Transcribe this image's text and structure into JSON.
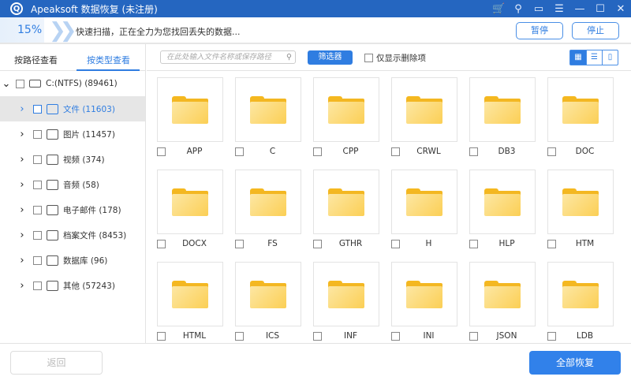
{
  "app": {
    "title": "Apeaksoft 数据恢复 (未注册)",
    "logo": "Q"
  },
  "titlebar_icons": [
    {
      "name": "cart-icon",
      "glyph": "🛒"
    },
    {
      "name": "key-icon",
      "glyph": "⚲"
    },
    {
      "name": "feedback-icon",
      "glyph": "▭"
    },
    {
      "name": "menu-icon",
      "glyph": "☰"
    },
    {
      "name": "minimize-icon",
      "glyph": "—"
    },
    {
      "name": "maximize-icon",
      "glyph": "☐"
    },
    {
      "name": "close-icon",
      "glyph": "✕"
    }
  ],
  "scan": {
    "percent_label": "15%",
    "percent": 15,
    "message": "快速扫描，正在全力为您找回丢失的数据...",
    "pause": "暂停",
    "stop": "停止"
  },
  "tabs": {
    "by_path": "按路径查看",
    "by_type": "按类型查看"
  },
  "tree": {
    "root": "C:(NTFS) (89461)",
    "items": [
      {
        "label": "文件 (11603)",
        "icon": "document-icon",
        "selected": true
      },
      {
        "label": "图片 (11457)",
        "icon": "image-icon"
      },
      {
        "label": "视频 (374)",
        "icon": "video-icon"
      },
      {
        "label": "音频 (58)",
        "icon": "audio-icon"
      },
      {
        "label": "电子邮件 (178)",
        "icon": "email-icon"
      },
      {
        "label": "档案文件 (8453)",
        "icon": "archive-icon"
      },
      {
        "label": "数据库 (96)",
        "icon": "database-icon"
      },
      {
        "label": "其他 (57243)",
        "icon": "folder-icon"
      }
    ]
  },
  "toolbar": {
    "search_placeholder": "在此处输入文件名称或保存路径",
    "filter": "筛选器",
    "deleted_only": "仅显示删除项"
  },
  "folders": [
    "APP",
    "C",
    "CPP",
    "CRWL",
    "DB3",
    "DOC",
    "DOCX",
    "FS",
    "GTHR",
    "H",
    "HLP",
    "HTM",
    "HTML",
    "ICS",
    "INF",
    "INI",
    "JSON",
    "LDB"
  ],
  "footer": {
    "back": "返回",
    "recover_all": "全部恢复"
  }
}
